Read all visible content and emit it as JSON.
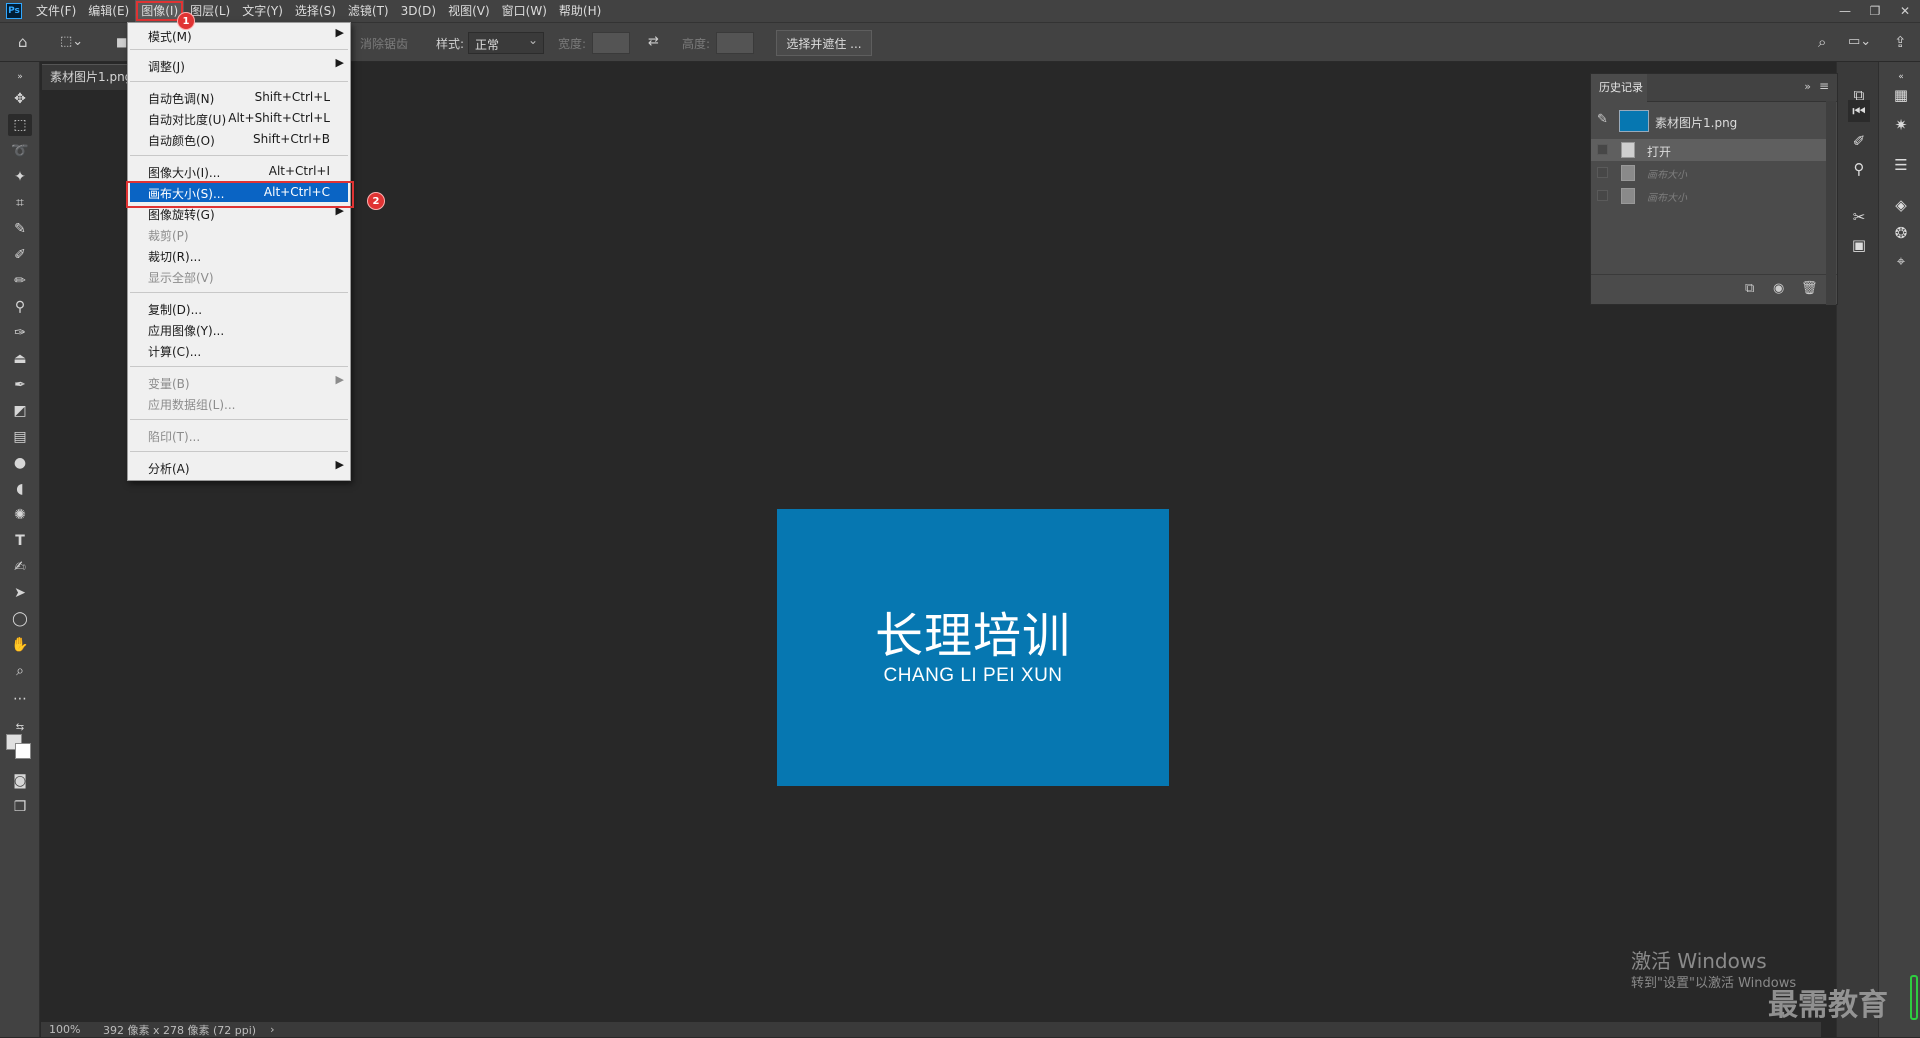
{
  "app": {
    "logo": "Ps"
  },
  "menubar": {
    "items": [
      "文件(F)",
      "编辑(E)",
      "图像(I)",
      "图层(L)",
      "文字(Y)",
      "选择(S)",
      "滤镜(T)",
      "3D(D)",
      "视图(V)",
      "窗口(W)",
      "帮助(H)"
    ],
    "active_index": 2
  },
  "window_controls": {
    "minimize": "—",
    "restore": "❐",
    "close": "✕"
  },
  "optionsbar": {
    "feather_label": "消除锯齿",
    "style_label": "样式:",
    "style_value": "正常",
    "width_label": "宽度:",
    "height_label": "高度:",
    "select_mask": "选择并遮住 ..."
  },
  "document": {
    "tab_name": "素材图片1.png",
    "art_title": "长理培训",
    "art_subtitle": "CHANG LI PEI XUN",
    "art_color": "#0677b1"
  },
  "statusbar": {
    "zoom": "100%",
    "dimensions": "392 像素 x 278 像素 (72 ppi)",
    "arrow": "›"
  },
  "image_menu": {
    "mode": {
      "label": "模式(M)"
    },
    "adjust": {
      "label": "调整(J)"
    },
    "auto_tone": {
      "label": "自动色调(N)",
      "shortcut": "Shift+Ctrl+L"
    },
    "auto_contrast": {
      "label": "自动对比度(U)",
      "shortcut": "Alt+Shift+Ctrl+L"
    },
    "auto_color": {
      "label": "自动颜色(O)",
      "shortcut": "Shift+Ctrl+B"
    },
    "image_size": {
      "label": "图像大小(I)...",
      "shortcut": "Alt+Ctrl+I"
    },
    "canvas_size": {
      "label": "画布大小(S)...",
      "shortcut": "Alt+Ctrl+C"
    },
    "rotation": {
      "label": "图像旋转(G)"
    },
    "crop": {
      "label": "裁剪(P)"
    },
    "trim": {
      "label": "裁切(R)..."
    },
    "reveal_all": {
      "label": "显示全部(V)"
    },
    "duplicate": {
      "label": "复制(D)..."
    },
    "apply_image": {
      "label": "应用图像(Y)..."
    },
    "calculations": {
      "label": "计算(C)..."
    },
    "variables": {
      "label": "变量(B)"
    },
    "apply_data_set": {
      "label": "应用数据组(L)..."
    },
    "trap": {
      "label": "陷印(T)..."
    },
    "analysis": {
      "label": "分析(A)"
    }
  },
  "badges": {
    "step1": "1",
    "step2": "2"
  },
  "history": {
    "tab": "历史记录",
    "snapshot_name": "素材图片1.png",
    "steps": [
      {
        "label": "打开",
        "state": "active"
      },
      {
        "label": "画布大小",
        "state": "future"
      },
      {
        "label": "画布大小",
        "state": "future"
      }
    ]
  },
  "overlay": {
    "activate_title": "激活 Windows",
    "activate_sub": "转到\"设置\"以激活 Windows",
    "brand": "最需教育"
  }
}
